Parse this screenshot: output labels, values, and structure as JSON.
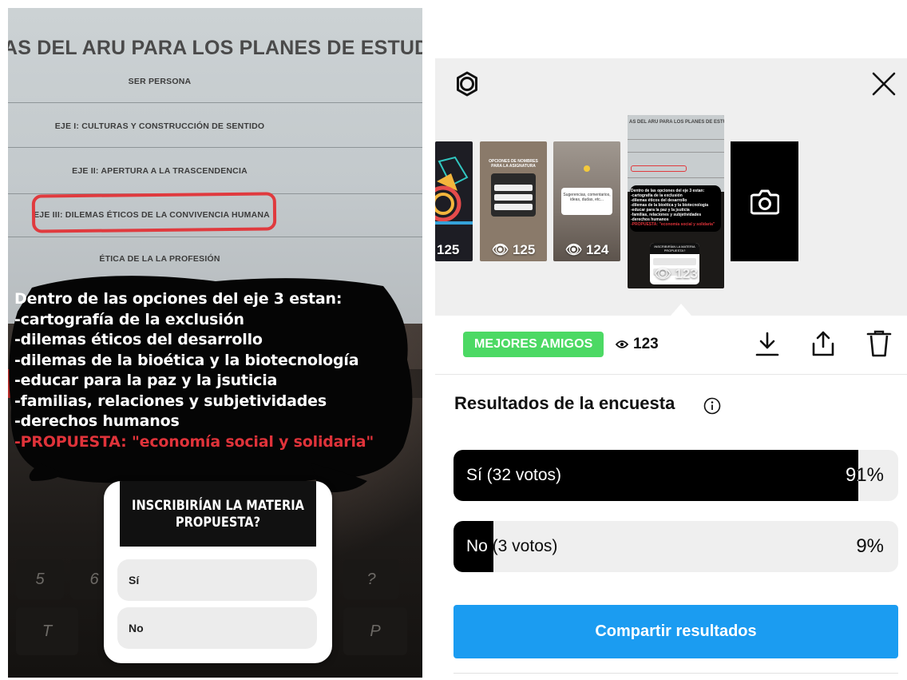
{
  "story": {
    "paper_title": "AS DEL ARU PARA LOS PLANES DE ESTUDIO SUJ",
    "rows": [
      "SER PERSONA",
      "EJE I: CULTURAS Y CONSTRUCCIÓN DE SENTIDO",
      "EJE II: APERTURA A LA TRASCENDENCIA",
      "EJE III: DILEMAS ÉTICOS DE LA CONVIVENCIA HUMANA",
      "ÉTICA DE LA LA PROFESIÓN"
    ],
    "text_lines": [
      "Dentro de las opciones del eje 3 estan:",
      "-cartografía de la exclusión",
      "-dilemas éticos del desarrollo",
      "-dilemas de la bioética y la biotecnología",
      "-educar para la paz y la jsuticia",
      "-familias, relaciones y subjetividades",
      "-derechos humanos"
    ],
    "highlight_line": "-PROPUESTA: \"economía social y solidaria\"",
    "poll": {
      "question_line1": "INSCRIBIRÍAN LA MATERIA",
      "question_line2": "PROPUESTA?",
      "option_yes": "Sí",
      "option_no": "No"
    },
    "keyboard_keys": [
      "%",
      "5",
      "&",
      "6",
      "T",
      "?",
      "P"
    ]
  },
  "viewer": {
    "thumbnails": [
      {
        "views": "125",
        "kind": "infographic"
      },
      {
        "views": "125",
        "kind": "names"
      },
      {
        "views": "124",
        "kind": "question"
      },
      {
        "views": "123",
        "kind": "current"
      }
    ],
    "thumb_texts": {
      "names_title": "OPCIONES DE NOMBRES PARA LA ASIGNATURA",
      "question_text": "Sugerencias, comentarios, ideas, dudas, etc...",
      "current_poll": "INSCRIBIRÍAN LA MATERIA PROPUESTA?"
    },
    "audience_badge": "MEJORES AMIGOS",
    "viewer_count": "123",
    "results_title": "Resultados de la encuesta",
    "results": [
      {
        "label": "Sí (32 votos)",
        "pct_text": "91%",
        "fraction": 0.91
      },
      {
        "label": "No (3 votos)",
        "pct_text": "9%",
        "fraction": 0.09
      }
    ],
    "share_label": "Compartir resultados"
  },
  "colors": {
    "badge_green": "#4cd964",
    "share_blue": "#1b9cf1",
    "highlight_red": "#e0333a"
  },
  "icons": [
    "gear-icon",
    "close-icon",
    "camera-icon",
    "eye-icon",
    "download-icon",
    "share-icon",
    "trash-icon",
    "info-icon"
  ]
}
